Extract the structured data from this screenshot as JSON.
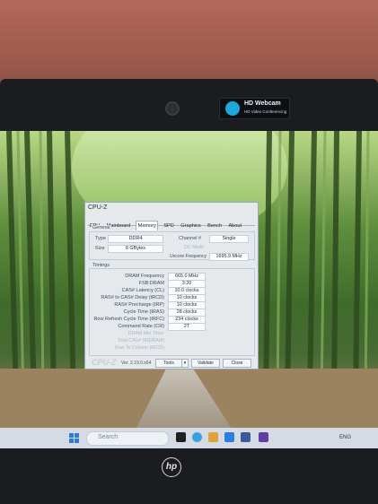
{
  "webcam_label": {
    "title": "HD Webcam",
    "subtitle": "HD Video Conferencing"
  },
  "window": {
    "title": "CPU-Z",
    "tabs": [
      "CPU",
      "Mainboard",
      "Memory",
      "SPD",
      "Graphics",
      "Bench",
      "About"
    ],
    "selected_tab": "Memory",
    "general": {
      "group_label": "General",
      "type_label": "Type",
      "type_value": "DDR4",
      "size_label": "Size",
      "size_value": "8 GBytes",
      "channel_label": "Channel #",
      "channel_value": "Single",
      "dc_mode_label": "DC Mode",
      "uncore_label": "Uncore Frequency",
      "uncore_value": "1695.9 MHz"
    },
    "timings": {
      "group_label": "Timings",
      "rows": [
        {
          "label": "DRAM Frequency",
          "value": "665.0 MHz"
        },
        {
          "label": "FSB:DRAM",
          "value": "3:20"
        },
        {
          "label": "CAS# Latency (CL)",
          "value": "10.0 clocks"
        },
        {
          "label": "RAS# to CAS# Delay (tRCD)",
          "value": "10 clocks"
        },
        {
          "label": "RAS# Precharge (tRP)",
          "value": "10 clocks"
        },
        {
          "label": "Cycle Time (tRAS)",
          "value": "28 clocks"
        },
        {
          "label": "Row Refresh Cycle Time (tRFC)",
          "value": "234 clocks"
        },
        {
          "label": "Command Rate (CR)",
          "value": "2T"
        },
        {
          "label": "DRAM Idle Timer",
          "value": ""
        },
        {
          "label": "Total CAS# (tRDRAM)",
          "value": ""
        },
        {
          "label": "Row To Column (tRCD)",
          "value": ""
        }
      ]
    },
    "footer": {
      "brand": "CPU-Z",
      "version": "Ver. 2.19.0.x64",
      "tools": "Tools",
      "validate": "Validate",
      "close": "Close"
    }
  },
  "taskbar": {
    "search_placeholder": "Search",
    "tray_text": "ENG"
  },
  "brand_logo": "hp",
  "colors": {
    "wall": "#a25c4f",
    "bezel": "#1b1c1f",
    "window": "#e6e9ec",
    "taskbar": "#d4dbe4"
  }
}
